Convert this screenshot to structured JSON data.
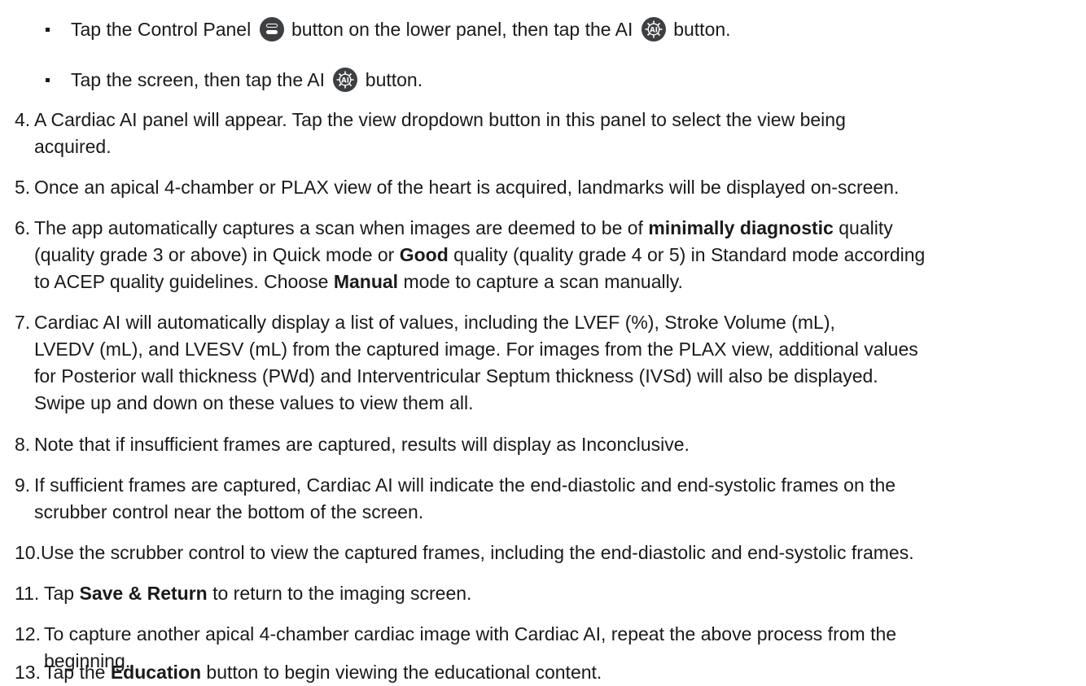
{
  "bullets": [
    {
      "before": "Tap the Control Panel",
      "middle": "button on the lower panel, then tap the AI",
      "after": "button.",
      "icons": [
        "control-panel-icon",
        "ai-icon"
      ]
    },
    {
      "before": "Tap the screen, then tap the AI",
      "after": "button.",
      "icons": [
        "ai-icon"
      ]
    }
  ],
  "steps": {
    "s4": {
      "num": "4.",
      "l1": "A Cardiac AI panel will appear. Tap the view dropdown button in this panel to select the view being",
      "l2": "acquired."
    },
    "s5": {
      "num": "5.",
      "l1": "Once an apical 4-chamber or PLAX view of the heart is acquired, landmarks will be displayed on-screen."
    },
    "s6": {
      "num": "6.",
      "a": "The app automatically captures a scan when images are deemed to be of",
      "b_bold": "minimally diagnostic",
      "c": "quality",
      "d": "(quality grade 3 or above) in Quick mode or",
      "e_bold": "Good",
      "f": "quality (quality grade 4 or 5) in Standard mode according",
      "g": "to ACEP quality guidelines. Choose",
      "h_bold": "Manual",
      "i": "mode to capture a scan manually."
    },
    "s7": {
      "num": "7.",
      "l1": "Cardiac AI will automatically display a list of values, including the LVEF (%), Stroke Volume (mL),",
      "l2": "LVEDV (mL), and LVESV (mL) from the captured image. For images from the PLAX view, additional values",
      "l3": "for Posterior wall thickness (PWd) and Interventricular Septum thickness (IVSd) will also be displayed.",
      "l4": "Swipe up and down on these values to view them all."
    },
    "s8": {
      "num": "8.",
      "l1": "Note that if insufficient frames are captured, results will display as Inconclusive."
    },
    "s9": {
      "num": "9.",
      "l1": "If sufficient frames are captured, Cardiac AI will indicate the end-diastolic and end-systolic frames on the",
      "l2": "scrubber control near the bottom of the screen."
    },
    "s10": {
      "num": "10.",
      "l1": "Use the scrubber control to view the captured frames, including the end-diastolic and end-systolic frames."
    },
    "s11": {
      "num": "11.",
      "a": "Tap",
      "b_bold": "Save & Return",
      "c": "to return to the imaging screen."
    },
    "s12": {
      "num": "12.",
      "l1": "To capture another apical 4-chamber cardiac image with Cardiac AI, repeat the above process from the",
      "l2": "beginning."
    },
    "s13": {
      "num": "13.",
      "a": "Tap the",
      "b_bold": "Education",
      "c": "button to begin viewing the educational content."
    }
  },
  "colors": {
    "text": "#1a1a1a",
    "icon_bg": "#3d3f42"
  }
}
